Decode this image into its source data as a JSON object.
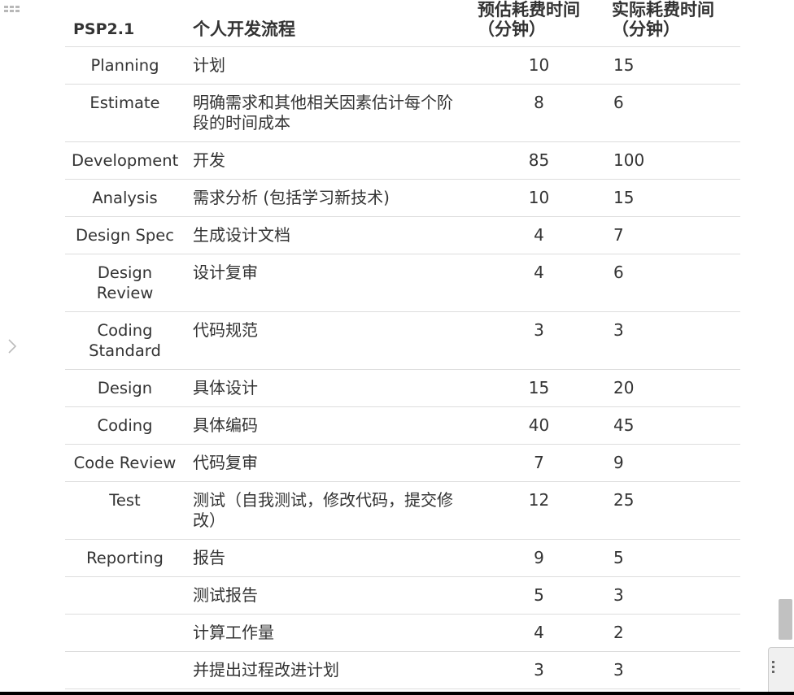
{
  "table": {
    "headers": {
      "step": "PSP2.1",
      "process": "个人开发流程",
      "estimated": "预估耗费时间\n（分钟）",
      "actual": "实际耗费时间\n（分钟）"
    },
    "rows": [
      {
        "step": "Planning",
        "desc": "计划",
        "est": "10",
        "act": "15"
      },
      {
        "step": "Estimate",
        "desc": "明确需求和其他相关因素估计每个阶段的时间成本",
        "est": "8",
        "act": "6"
      },
      {
        "step": "Development",
        "desc": "开发",
        "est": "85",
        "act": "100"
      },
      {
        "step": "Analysis",
        "desc": "需求分析 (包括学习新技术)",
        "est": "10",
        "act": "15"
      },
      {
        "step": "Design Spec",
        "desc": "生成设计文档",
        "est": "4",
        "act": "7"
      },
      {
        "step": "Design Review",
        "desc": "设计复审",
        "est": "4",
        "act": "6"
      },
      {
        "step": "Coding Standard",
        "desc": "代码规范",
        "est": "3",
        "act": "3"
      },
      {
        "step": "Design",
        "desc": "具体设计",
        "est": "15",
        "act": "20"
      },
      {
        "step": "Coding",
        "desc": "具体编码",
        "est": "40",
        "act": "45"
      },
      {
        "step": "Code Review",
        "desc": "代码复审",
        "est": "7",
        "act": "9"
      },
      {
        "step": "Test",
        "desc": "测试（自我测试，修改代码，提交修改）",
        "est": "12",
        "act": "25"
      },
      {
        "step": "Reporting",
        "desc": "报告",
        "est": "9",
        "act": "5"
      },
      {
        "step": "",
        "desc": "测试报告",
        "est": "5",
        "act": "3"
      },
      {
        "step": "",
        "desc": "计算工作量",
        "est": "4",
        "act": "2"
      },
      {
        "step": "",
        "desc": "并提出过程改进计划",
        "est": "3",
        "act": "3"
      }
    ]
  },
  "icons": {
    "menu": "grid-menu-icon",
    "side_arrow": "chevron-right-icon",
    "corner": "vertical-dots-icon"
  }
}
